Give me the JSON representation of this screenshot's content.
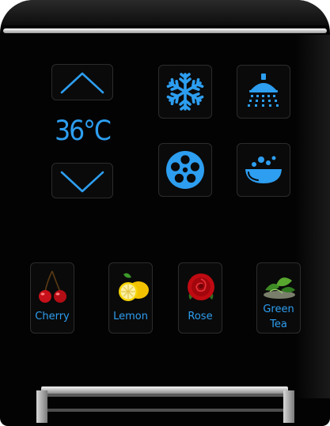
{
  "temperature": {
    "value": "36°C",
    "increase": "increase-temperature",
    "decrease": "decrease-temperature"
  },
  "modes": [
    {
      "icon": "snowflake-icon"
    },
    {
      "icon": "shower-head-icon"
    },
    {
      "icon": "film-reel-icon"
    },
    {
      "icon": "bathtub-icon"
    }
  ],
  "fragrances": [
    {
      "label": "Cherry",
      "icon": "cherry-icon"
    },
    {
      "label": "Lemon",
      "icon": "lemon-icon"
    },
    {
      "label": "Rose",
      "icon": "rose-icon"
    },
    {
      "label": "Green",
      "label_line2": "Tea",
      "icon": "green-tea-icon"
    }
  ],
  "colors": {
    "accent": "#2d9ef0",
    "body": "#030303",
    "key_border": "#2c2c2c",
    "trim": "#e8e8e8"
  }
}
